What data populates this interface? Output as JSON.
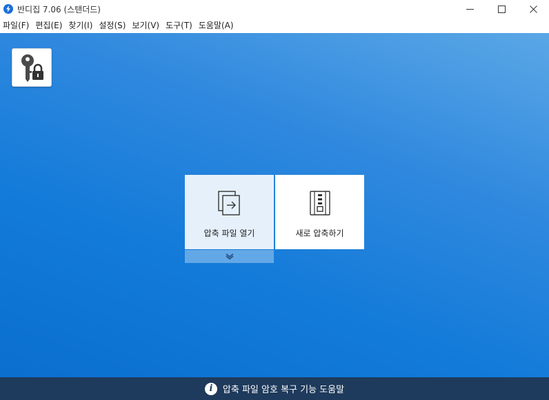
{
  "window": {
    "title": "반디집 7.06 (스탠더드)",
    "controls": [
      "minimize-icon",
      "maximize-icon",
      "close-icon"
    ]
  },
  "menu": {
    "items": [
      {
        "label": "파일(F)"
      },
      {
        "label": "편집(E)"
      },
      {
        "label": "찾기(I)"
      },
      {
        "label": "설정(S)"
      },
      {
        "label": "보기(V)"
      },
      {
        "label": "도구(T)"
      },
      {
        "label": "도움말(A)"
      }
    ]
  },
  "toolbar": {
    "password_tool_icon": "key-lock-icon"
  },
  "tiles": {
    "open": {
      "label": "압축 파일 열기",
      "icon": "open-archive-icon",
      "dropdown_icon": "chevron-down-icon"
    },
    "new": {
      "label": "새로 압축하기",
      "icon": "zip-archive-icon"
    }
  },
  "status": {
    "text": "압축 파일 암호 복구 기능 도움말",
    "icon": "info-icon"
  },
  "colors": {
    "accent": "#1a6fd8",
    "workspace_top": "#5aa7e6",
    "workspace_bottom": "#0a6fcf",
    "statusbar": "#1e3a5c",
    "tile_selected": "#e6f0fa",
    "dropdown": "#63a8e6"
  }
}
